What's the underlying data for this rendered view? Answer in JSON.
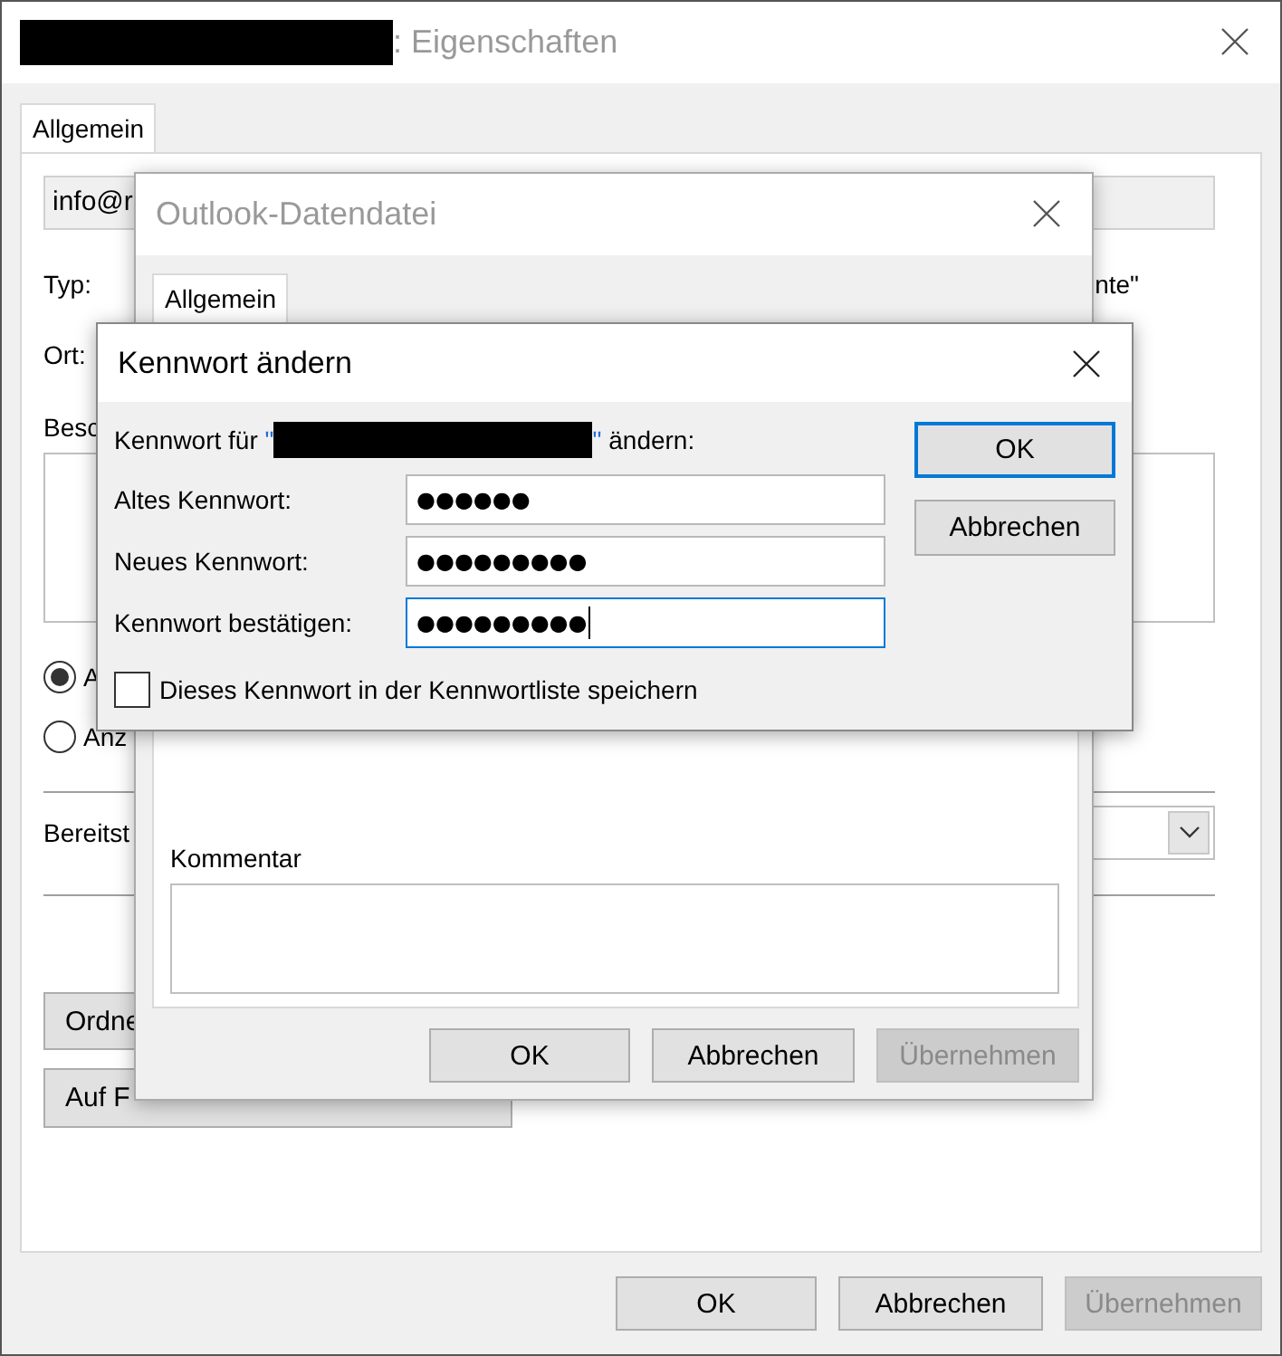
{
  "properties_window": {
    "title": ": Eigenschaften",
    "tabs": [
      {
        "label": "Allgemein",
        "selected": true
      }
    ],
    "address_field": {
      "value": "info@r"
    },
    "type_label": "Typ:",
    "type_value": "nte\"",
    "location_label": "Ort:",
    "description_label": "Besc",
    "radios": [
      {
        "label": "A",
        "selected": true
      },
      {
        "label": "Anz",
        "selected": false
      }
    ],
    "provision_label": "Bereitst",
    "panel_buttons": [
      "Ordne",
      "Auf F"
    ],
    "buttons": [
      {
        "label": "OK",
        "disabled": false
      },
      {
        "label": "Abbrechen",
        "disabled": false
      },
      {
        "label": "Übernehmen",
        "disabled": true
      }
    ]
  },
  "data_file_window": {
    "title": "Outlook-Datendatei",
    "tabs": [
      {
        "label": "Allgemein",
        "selected": true
      }
    ],
    "comment_label": "Kommentar",
    "buttons": [
      {
        "label": "OK",
        "disabled": false
      },
      {
        "label": "Abbrechen",
        "disabled": false
      },
      {
        "label": "Übernehmen",
        "disabled": true
      }
    ]
  },
  "password_dialog": {
    "title": "Kennwort ändern",
    "prompt_before": "Kennwort für",
    "open_quote": "\"",
    "close_quote": "\"",
    "prompt_after": "ändern:",
    "fields": [
      {
        "label": "Altes Kennwort:",
        "value": "●●●●●●",
        "focused": false
      },
      {
        "label": "Neues Kennwort:",
        "value": "●●●●●●●●●",
        "focused": false
      },
      {
        "label": "Kennwort bestätigen:",
        "value": "●●●●●●●●●",
        "focused": true
      }
    ],
    "save_checkbox": {
      "label": "Dieses Kennwort in der Kennwortliste speichern",
      "checked": false
    },
    "buttons": [
      {
        "label": "OK",
        "default": true
      },
      {
        "label": "Abbrechen",
        "default": false
      }
    ]
  }
}
